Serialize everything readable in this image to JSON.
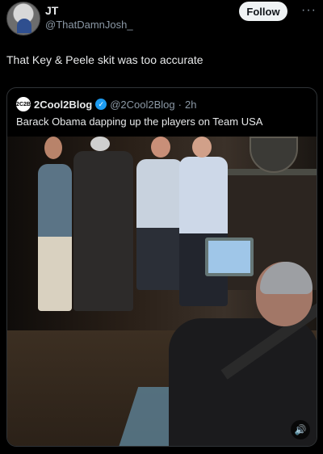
{
  "tweet": {
    "author_name": "JT",
    "author_handle": "@ThatDamnJosh_",
    "follow_label": "Follow",
    "more_label": "···",
    "text": "That Key & Peele skit was too accurate"
  },
  "quote": {
    "avatar_label": "2C2B",
    "author_name": "2Cool2Blog",
    "author_handle": "@2Cool2Blog",
    "separator": "·",
    "time": "2h",
    "text": "Barack Obama dapping up the players on Team USA"
  },
  "icons": {
    "verified": "verified-badge-icon",
    "sound": "speaker-icon",
    "more": "more-dots-icon"
  },
  "colors": {
    "background": "#000000",
    "text": "#e7e9ea",
    "muted": "#8b98a5",
    "follow_bg": "#eff3f4",
    "verified": "#1d9bf0"
  }
}
